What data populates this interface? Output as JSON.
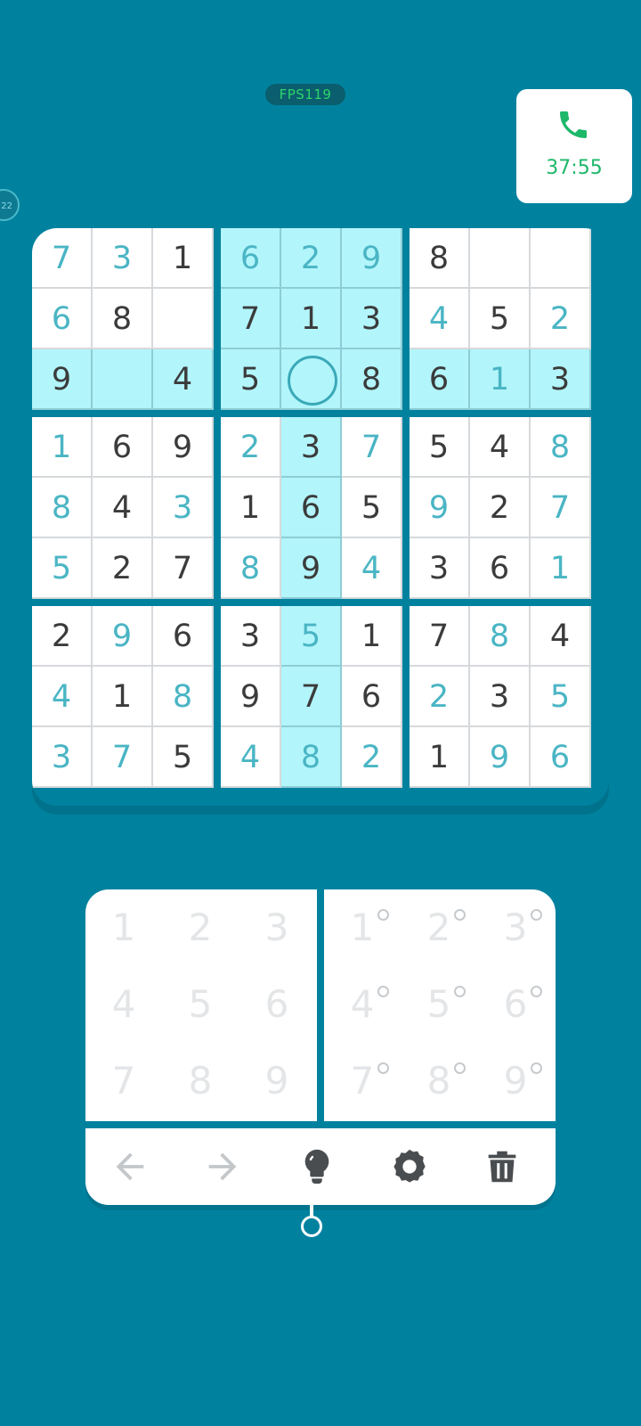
{
  "status": {
    "fps_label": "FPS119"
  },
  "call": {
    "timer": "37:55"
  },
  "side_badge": "22",
  "board": {
    "rows": [
      [
        "7",
        "3",
        "1",
        "6",
        "2",
        "9",
        "8",
        "",
        ""
      ],
      [
        "6",
        "8",
        "",
        "7",
        "1",
        "3",
        "4",
        "5",
        "2"
      ],
      [
        "9",
        "",
        "4",
        "5",
        "",
        "8",
        "6",
        "1",
        "3"
      ],
      [
        "1",
        "6",
        "9",
        "2",
        "3",
        "7",
        "5",
        "4",
        "8"
      ],
      [
        "8",
        "4",
        "3",
        "1",
        "6",
        "5",
        "9",
        "2",
        "7"
      ],
      [
        "5",
        "2",
        "7",
        "8",
        "9",
        "4",
        "3",
        "6",
        "1"
      ],
      [
        "2",
        "9",
        "6",
        "3",
        "5",
        "1",
        "7",
        "8",
        "4"
      ],
      [
        "4",
        "1",
        "8",
        "9",
        "7",
        "6",
        "2",
        "3",
        "5"
      ],
      [
        "3",
        "7",
        "5",
        "4",
        "8",
        "2",
        "1",
        "9",
        "6"
      ]
    ],
    "user_entered": [
      [
        true,
        true,
        false,
        true,
        true,
        true,
        false,
        false,
        false
      ],
      [
        true,
        false,
        false,
        false,
        false,
        false,
        true,
        false,
        true
      ],
      [
        false,
        false,
        false,
        false,
        false,
        false,
        false,
        true,
        false
      ],
      [
        true,
        false,
        false,
        true,
        false,
        true,
        false,
        false,
        true
      ],
      [
        true,
        false,
        true,
        false,
        false,
        false,
        true,
        false,
        true
      ],
      [
        true,
        false,
        false,
        true,
        false,
        true,
        false,
        false,
        true
      ],
      [
        false,
        true,
        false,
        false,
        true,
        false,
        false,
        true,
        false
      ],
      [
        true,
        false,
        true,
        false,
        false,
        false,
        true,
        false,
        true
      ],
      [
        true,
        true,
        false,
        true,
        true,
        true,
        false,
        true,
        true
      ]
    ],
    "selected": {
      "row": 2,
      "col": 4
    }
  },
  "numpad": {
    "digits": [
      "1",
      "2",
      "3",
      "4",
      "5",
      "6",
      "7",
      "8",
      "9"
    ],
    "note_digits": [
      "1",
      "2",
      "3",
      "4",
      "5",
      "6",
      "7",
      "8",
      "9"
    ]
  },
  "toolbar": {
    "tools": [
      {
        "icon": "arrow-left-icon"
      },
      {
        "icon": "arrow-right-icon"
      },
      {
        "icon": "lightbulb-icon"
      },
      {
        "icon": "gear-icon"
      },
      {
        "icon": "trash-icon"
      }
    ]
  },
  "colors": {
    "background": "#00829f",
    "highlight": "#b2f5fb",
    "user_digit": "#4ab5c4",
    "given_digit": "#3b3b3b",
    "timer": "#1db86a"
  }
}
